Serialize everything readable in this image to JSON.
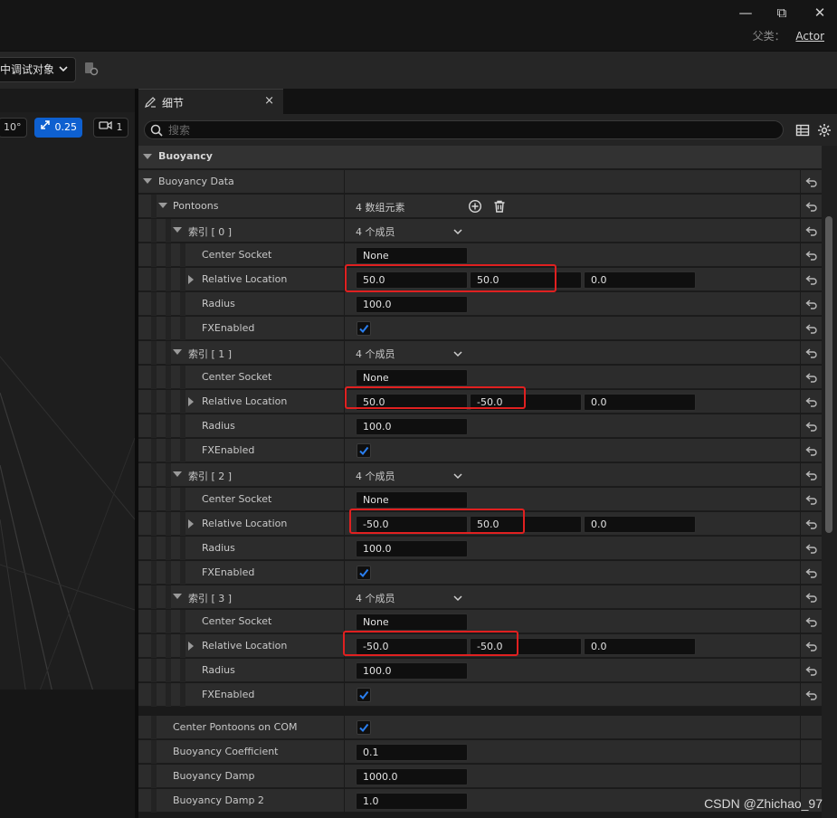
{
  "window": {
    "minimize": "—",
    "restore": "⧉",
    "close": "✕",
    "parent_class_label": "父类：",
    "parent_class_value": "Actor"
  },
  "toolbar": {
    "debug_dropdown": "中调试对象"
  },
  "viewport": {
    "rotation_snap": "10°",
    "scale_snap": "0.25",
    "camera_speed": "1"
  },
  "details": {
    "tab_title": "细节",
    "tab_close": "×",
    "search_placeholder": "搜索",
    "category": "Buoyancy",
    "buoyancy_data": "Buoyancy Data",
    "pontoons": "Pontoons",
    "pontoons_count": "4 数组元素",
    "labels": {
      "center_socket": "Center Socket",
      "relative_location": "Relative Location",
      "radius": "Radius",
      "fx_enabled": "FXEnabled",
      "members": "4 个成员"
    },
    "pontoon_items": [
      {
        "index": "索引 [ 0 ]",
        "center_socket": "None",
        "loc_x": "50.0",
        "loc_y": "50.0",
        "loc_z": "0.0",
        "radius": "100.0",
        "fx": true
      },
      {
        "index": "索引 [ 1 ]",
        "center_socket": "None",
        "loc_x": "50.0",
        "loc_y": "-50.0",
        "loc_z": "0.0",
        "radius": "100.0",
        "fx": true
      },
      {
        "index": "索引 [ 2 ]",
        "center_socket": "None",
        "loc_x": "-50.0",
        "loc_y": "50.0",
        "loc_z": "0.0",
        "radius": "100.0",
        "fx": true
      },
      {
        "index": "索引 [ 3 ]",
        "center_socket": "None",
        "loc_x": "-50.0",
        "loc_y": "-50.0",
        "loc_z": "0.0",
        "radius": "100.0",
        "fx": true
      }
    ],
    "center_pontoons_on_com": {
      "label": "Center Pontoons on COM",
      "value": true
    },
    "buoyancy_coefficient": {
      "label": "Buoyancy Coefficient",
      "value": "0.1"
    },
    "buoyancy_damp": {
      "label": "Buoyancy Damp",
      "value": "1000.0"
    },
    "buoyancy_damp2": {
      "label": "Buoyancy Damp 2",
      "value": "1.0"
    }
  },
  "watermark": "CSDN @Zhichao_97",
  "colors": {
    "accent_blue": "#0e60d0",
    "highlight_red": "#e02020",
    "panel_bg": "#2c2c2c"
  }
}
